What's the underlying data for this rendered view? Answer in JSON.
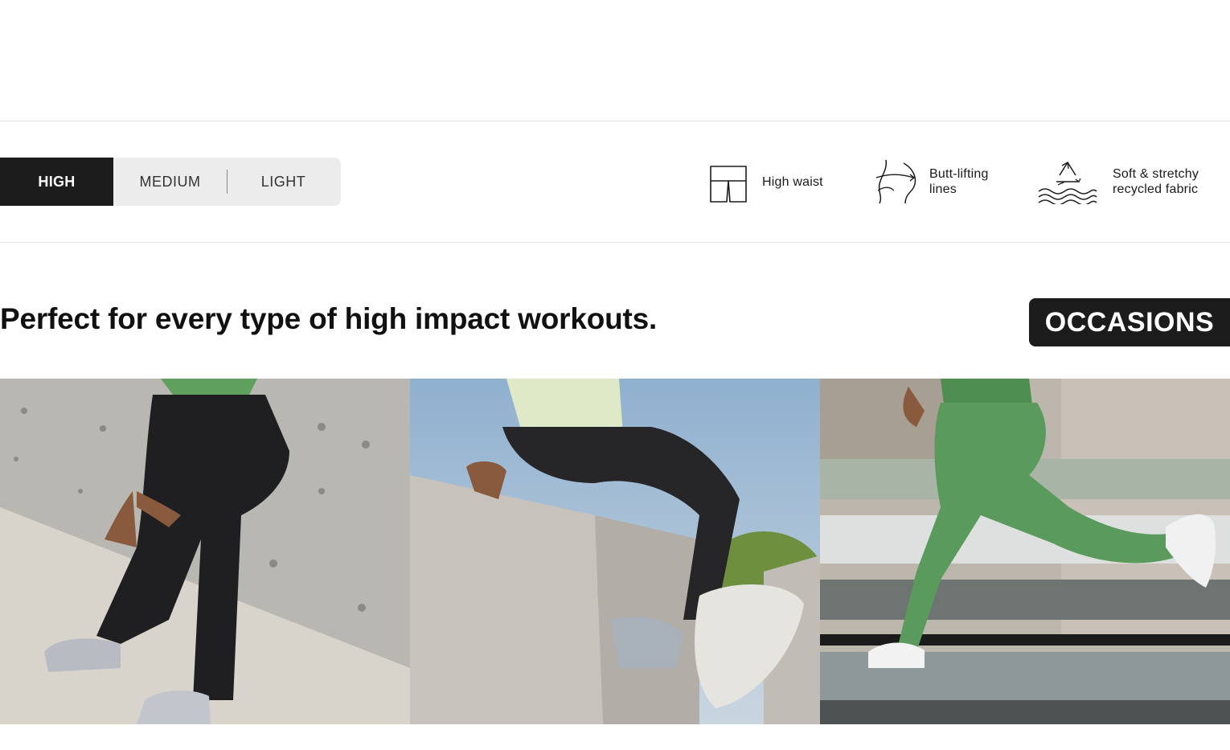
{
  "intensity_tabs": {
    "items": [
      "HIGH",
      "MEDIUM",
      "LIGHT"
    ],
    "active": "HIGH"
  },
  "features": [
    {
      "icon": "high-waist-icon",
      "label_line1": "High waist",
      "label_line2": ""
    },
    {
      "icon": "butt-lift-icon",
      "label_line1": "Butt-lifting",
      "label_line2": "lines"
    },
    {
      "icon": "recycle-water-icon",
      "label_line1": "Soft & stretchy",
      "label_line2": "recycled fabric"
    }
  ],
  "occasions": {
    "headline": "Perfect for every type of high impact workouts.",
    "badge": "OCCASIONS"
  },
  "photos": [
    {
      "subject": "leaning-against-concrete-wall",
      "legging_color": "#1f1f22"
    },
    {
      "subject": "sitting-on-concrete-block",
      "legging_color": "#262628"
    },
    {
      "subject": "running-by-water",
      "legging_color": "#5a9a5c"
    }
  ]
}
